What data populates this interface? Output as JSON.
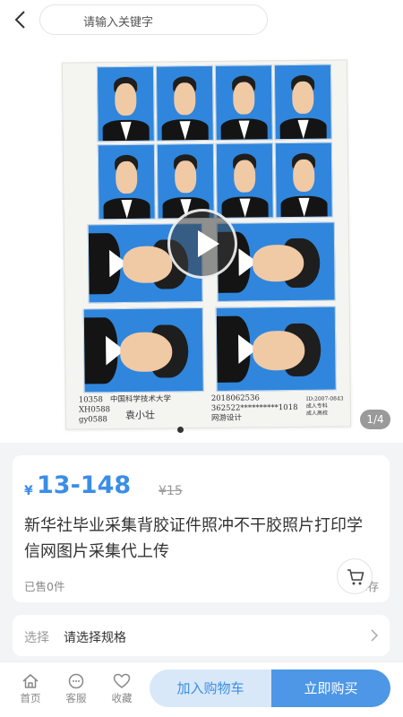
{
  "search": {
    "placeholder": "请输入关键字"
  },
  "gallery": {
    "counter": "1/4",
    "photo_captions": {
      "line1": "10358   中国科学技术大学",
      "line2": "XH0588",
      "line3": "gy0588",
      "name": "袁小壮",
      "id1": "2018062536",
      "id2": "362522**********1018",
      "note": "网游设计",
      "small": "ID:2007-0843\n成人专科\n成人高校"
    }
  },
  "product": {
    "currency": "¥",
    "price": "13-148",
    "original_price": "¥15",
    "title": "新华社毕业采集背胶证件照冲不干胶照片打印学信网图片采集代上传",
    "sold": "已售0件",
    "stock": "1 库存"
  },
  "spec": {
    "label": "选择",
    "value": "请选择规格"
  },
  "bottom_nav": {
    "home": "首页",
    "service": "客服",
    "favorite": "收藏"
  },
  "actions": {
    "add_to_cart": "加入购物车",
    "buy_now": "立即购买"
  },
  "colors": {
    "accent": "#3a8ee6",
    "photo_bg": "#2f86dc"
  }
}
